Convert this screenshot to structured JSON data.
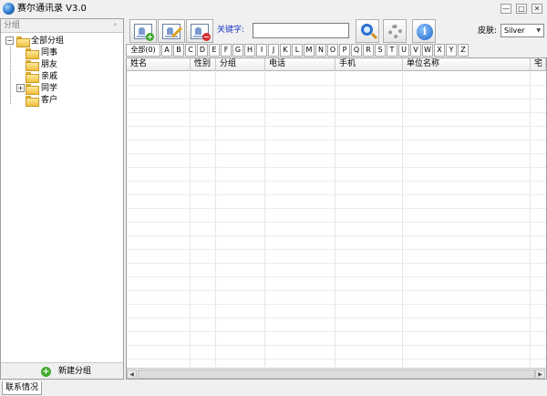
{
  "window": {
    "title": "赛尔通讯录 V3.0",
    "controls": {
      "minimize": "—",
      "maximize": "□",
      "close": "✕"
    }
  },
  "left_panel": {
    "title": "分组",
    "pin": "ᵖ",
    "tree": {
      "root": {
        "label": "全部分组",
        "expander": "−"
      },
      "items": [
        {
          "label": "同事",
          "expander": ""
        },
        {
          "label": "朋友",
          "expander": ""
        },
        {
          "label": "亲戚",
          "expander": ""
        },
        {
          "label": "同学",
          "expander": "+"
        },
        {
          "label": "客户",
          "expander": ""
        }
      ]
    },
    "new_group_label": "新建分组"
  },
  "toolbar": {
    "keyword_label": "关键字:",
    "keyword_value": "",
    "skin_label": "皮肤:",
    "skin_value": "Silver",
    "add_badge": "+",
    "delete_badge": "−",
    "info_glyph": "i",
    "dropdown_arrow": "▼"
  },
  "letter_filter": [
    "全部(0)",
    "A",
    "B",
    "C",
    "D",
    "E",
    "F",
    "G",
    "H",
    "I",
    "J",
    "K",
    "L",
    "M",
    "N",
    "O",
    "P",
    "Q",
    "R",
    "S",
    "T",
    "U",
    "V",
    "W",
    "X",
    "Y",
    "Z"
  ],
  "table": {
    "columns": [
      "姓名",
      "性别",
      "分组",
      "电话",
      "手机",
      "单位名称",
      "宅"
    ],
    "rows": []
  },
  "scrollbar": {
    "left_arrow": "◀",
    "right_arrow": "▶"
  },
  "bottom_tab": "联系情况"
}
